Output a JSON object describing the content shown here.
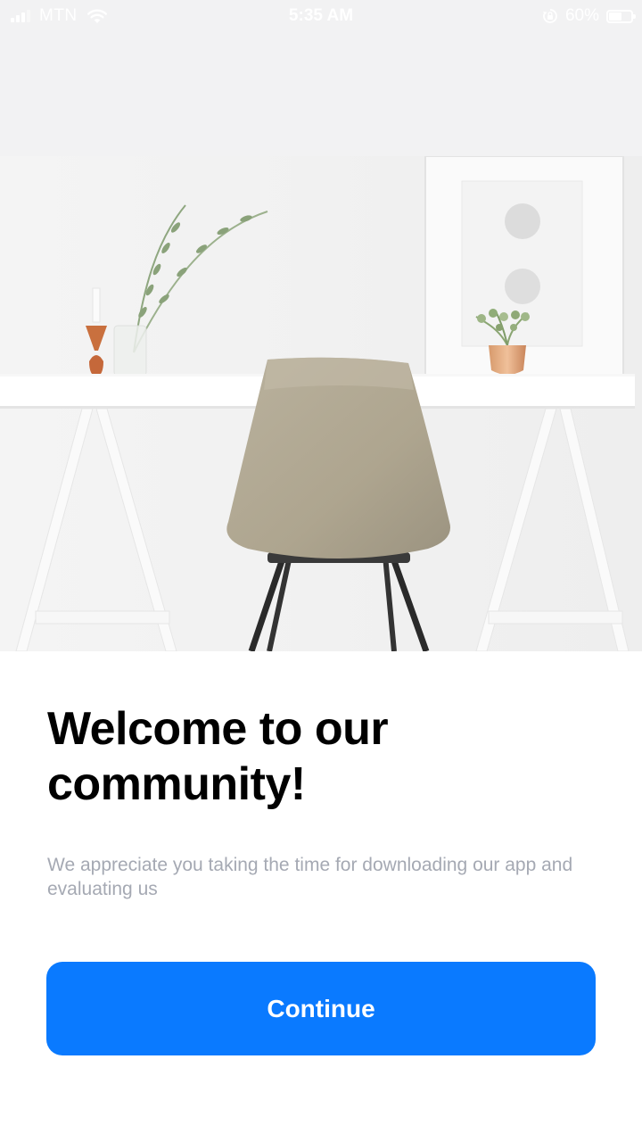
{
  "status_bar": {
    "carrier": "MTN",
    "time": "5:35 AM",
    "battery_percent": "60%",
    "battery_level": 0.6,
    "icons": [
      "signal-icon",
      "wifi-icon",
      "orientation-lock-icon",
      "battery-icon"
    ]
  },
  "hero": {
    "icon": "desk-chair-photo"
  },
  "welcome": {
    "title": "Welcome to our community!",
    "subtitle": "We appreciate you taking the time for downloading our app and evaluating us"
  },
  "actions": {
    "continue_label": "Continue"
  },
  "colors": {
    "primary": "#0a7aff",
    "title": "#000000",
    "subtitle": "#a5a9b3",
    "background": "#ffffff",
    "top_area": "#f2f2f3"
  }
}
